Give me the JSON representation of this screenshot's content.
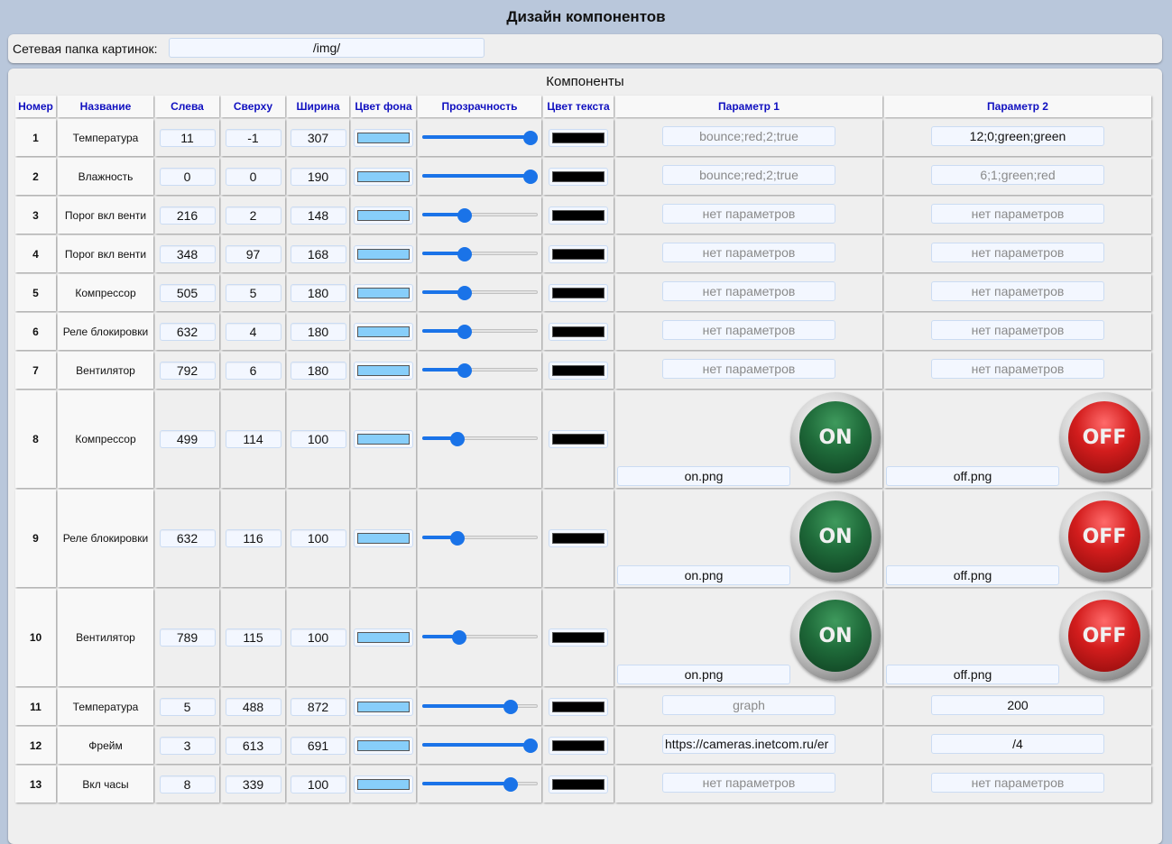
{
  "page": {
    "title": "Дизайн компонентов"
  },
  "folder": {
    "label": "Сетевая папка картинок:",
    "value": "/img/"
  },
  "components": {
    "title": "Компоненты",
    "headers": [
      "Номер",
      "Название",
      "Слева",
      "Сверху",
      "Ширина",
      "Цвет фона",
      "Прозрачность",
      "Цвет текста",
      "Параметр 1",
      "Параметр 2"
    ],
    "bg_color": "#87cefa",
    "text_color": "#000000",
    "accent_color": "#1a73e8",
    "rows": [
      {
        "num": "1",
        "name": "Температура",
        "left": "11",
        "top": "-1",
        "width": "307",
        "opacity": 1.0,
        "p1": {
          "value": "bounce;red;2;true",
          "placeholder": true
        },
        "p2": {
          "value": "12;0;green;green",
          "placeholder": false
        }
      },
      {
        "num": "2",
        "name": "Влажность",
        "left": "0",
        "top": "0",
        "width": "190",
        "opacity": 1.0,
        "p1": {
          "value": "bounce;red;2;true",
          "placeholder": true
        },
        "p2": {
          "value": "6;1;green;red",
          "placeholder": true
        }
      },
      {
        "num": "3",
        "name": "Порог вкл венти",
        "left": "216",
        "top": "2",
        "width": "148",
        "opacity": 0.35,
        "p1": {
          "value": "нет параметров",
          "placeholder": true
        },
        "p2": {
          "value": "нет параметров",
          "placeholder": true
        }
      },
      {
        "num": "4",
        "name": "Порог вкл венти",
        "left": "348",
        "top": "97",
        "width": "168",
        "opacity": 0.35,
        "p1": {
          "value": "нет параметров",
          "placeholder": true
        },
        "p2": {
          "value": "нет параметров",
          "placeholder": true
        }
      },
      {
        "num": "5",
        "name": "Компрессор",
        "left": "505",
        "top": "5",
        "width": "180",
        "opacity": 0.35,
        "p1": {
          "value": "нет параметров",
          "placeholder": true
        },
        "p2": {
          "value": "нет параметров",
          "placeholder": true
        }
      },
      {
        "num": "6",
        "name": "Реле блокировки",
        "left": "632",
        "top": "4",
        "width": "180",
        "opacity": 0.35,
        "p1": {
          "value": "нет параметров",
          "placeholder": true
        },
        "p2": {
          "value": "нет параметров",
          "placeholder": true
        }
      },
      {
        "num": "7",
        "name": "Вентилятор",
        "left": "792",
        "top": "6",
        "width": "180",
        "opacity": 0.35,
        "p1": {
          "value": "нет параметров",
          "placeholder": true
        },
        "p2": {
          "value": "нет параметров",
          "placeholder": true
        }
      },
      {
        "num": "8",
        "name": "Компрессор",
        "left": "499",
        "top": "114",
        "width": "100",
        "opacity": 0.28,
        "image": true,
        "p1": {
          "value": "on.png",
          "btn": "ON",
          "icon": "on-button-icon"
        },
        "p2": {
          "value": "off.png",
          "btn": "OFF",
          "icon": "off-button-icon"
        }
      },
      {
        "num": "9",
        "name": "Реле блокировки",
        "left": "632",
        "top": "116",
        "width": "100",
        "opacity": 0.28,
        "image": true,
        "p1": {
          "value": "on.png",
          "btn": "ON",
          "icon": "on-button-icon"
        },
        "p2": {
          "value": "off.png",
          "btn": "OFF",
          "icon": "off-button-icon"
        }
      },
      {
        "num": "10",
        "name": "Вентилятор",
        "left": "789",
        "top": "115",
        "width": "100",
        "opacity": 0.3,
        "image": true,
        "p1": {
          "value": "on.png",
          "btn": "ON",
          "icon": "on-button-icon"
        },
        "p2": {
          "value": "off.png",
          "btn": "OFF",
          "icon": "off-button-icon"
        }
      },
      {
        "num": "11",
        "name": "Температура",
        "left": "5",
        "top": "488",
        "width": "872",
        "opacity": 0.81,
        "p1": {
          "value": "graph",
          "placeholder": true
        },
        "p2": {
          "value": "200",
          "placeholder": false
        }
      },
      {
        "num": "12",
        "name": "Фрейм",
        "left": "3",
        "top": "613",
        "width": "691",
        "opacity": 1.0,
        "p1": {
          "value": "https://cameras.inetcom.ru/er",
          "placeholder": false,
          "left": true
        },
        "p2": {
          "value": "/4",
          "placeholder": false
        }
      },
      {
        "num": "13",
        "name": "Вкл часы",
        "left": "8",
        "top": "339",
        "width": "100",
        "opacity": 0.81,
        "p1": {
          "value": "нет параметров",
          "placeholder": true
        },
        "p2": {
          "value": "нет параметров",
          "placeholder": true
        }
      }
    ]
  }
}
